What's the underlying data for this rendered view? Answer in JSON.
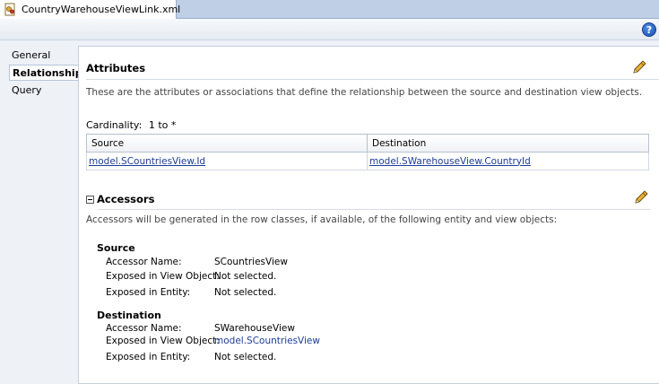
{
  "tab": {
    "title": "CountryWarehouseViewLink.xml",
    "icon": "xml-file-icon"
  },
  "toolbar": {
    "help_icon": "help-icon",
    "help_glyph": "?"
  },
  "nav": {
    "items": [
      {
        "label": "General",
        "active": false
      },
      {
        "label": "Relationship",
        "active": true
      },
      {
        "label": "Query",
        "active": false
      }
    ]
  },
  "attributes": {
    "heading": "Attributes",
    "description": "These are the attributes or associations that define the relationship between the source and destination view objects.",
    "cardinality_label": "Cardinality:",
    "cardinality_value": "1 to *",
    "table": {
      "columns": [
        "Source",
        "Destination"
      ],
      "rows": [
        [
          "model.SCountriesView.Id",
          "model.SWarehouseView.CountryId"
        ]
      ]
    }
  },
  "accessors": {
    "heading": "Accessors",
    "description": "Accessors will be generated in the row classes, if available, of the following entity and view objects:",
    "source": {
      "title": "Source",
      "accessor_name_label": "Accessor Name:",
      "accessor_name": "SCountriesView",
      "exposed_view_label": "Exposed in View Object:",
      "exposed_view": "Not selected.",
      "exposed_entity_label": "Exposed in Entity:",
      "exposed_entity": "Not selected."
    },
    "destination": {
      "title": "Destination",
      "accessor_name_label": "Accessor Name:",
      "accessor_name": "SWarehouseView",
      "exposed_view_label": "Exposed in View Object:",
      "exposed_view": "model.SCountriesView",
      "exposed_entity_label": "Exposed in Entity:",
      "exposed_entity": "Not selected."
    }
  },
  "colors": {
    "link": "#1d3c97",
    "tabstrip": "#bfcfe6",
    "pencil": "#d99a1c"
  }
}
